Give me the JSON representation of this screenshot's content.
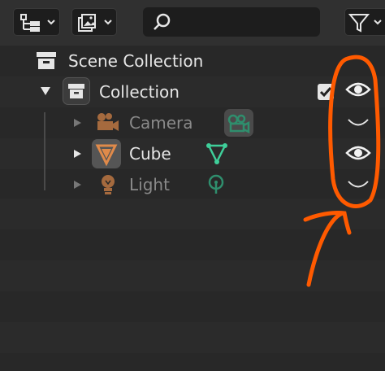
{
  "outliner": {
    "items": [
      {
        "label": "Scene Collection"
      },
      {
        "label": "Collection"
      },
      {
        "label": "Camera"
      },
      {
        "label": "Cube"
      },
      {
        "label": "Light"
      }
    ]
  },
  "colors": {
    "panel_bg": "#282828",
    "header_bg": "#303030",
    "text": "#e6e6e6",
    "text_dim": "#8a8a8a",
    "object_orange": "#e08a4a",
    "data_green": "#3fcf9a",
    "annotation_orange": "#ff5a00",
    "eye_white": "#f2f2f2"
  }
}
